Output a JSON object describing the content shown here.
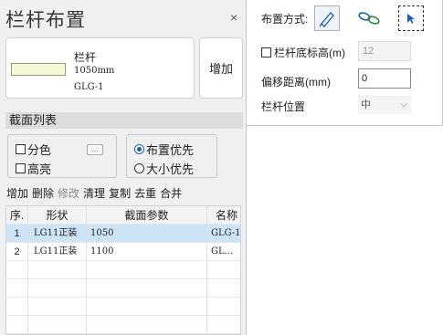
{
  "panel": {
    "title": "栏杆布置",
    "close_glyph": "×",
    "preview": {
      "name": "栏杆",
      "size": "1050mm",
      "code": "GLG-1"
    },
    "add_label": "增加",
    "section_header": "截面列表",
    "options": {
      "split_color": "分色",
      "highlight": "高亮",
      "more": "...",
      "layout_priority": "布置优先",
      "size_priority": "大小优先"
    },
    "toolbar": {
      "add": "增加",
      "delete": "删除",
      "modify": "修改",
      "clear": "清理",
      "copy": "复制",
      "dedupe": "去重",
      "merge": "合并"
    },
    "table": {
      "headers": [
        "序.",
        "形状",
        "截面参数",
        "名称"
      ],
      "rows": [
        {
          "index": "1",
          "shape": "LG11正装",
          "param": "1050",
          "name": "GLG-1"
        },
        {
          "index": "2",
          "shape": "LG11正装",
          "param": "1100",
          "name": "GL..."
        }
      ]
    }
  },
  "settings": {
    "layout_mode_label": "布置方式:",
    "bottom_elevation_label": "栏杆底标高(m)",
    "bottom_elevation_value": "12",
    "offset_label": "偏移距离(mm)",
    "offset_value": "0",
    "position_label": "栏杆位置",
    "position_value": "中",
    "icons": [
      "straight-line-icon",
      "chain-link-icon",
      "pick-select-icon"
    ]
  },
  "colors": {
    "selected_row": "#cce4f7",
    "accent": "#1a5fb4"
  }
}
